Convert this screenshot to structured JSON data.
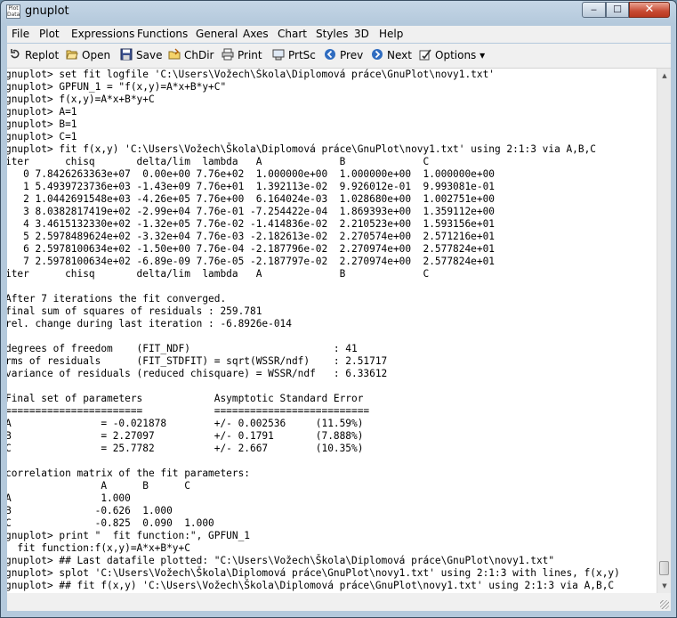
{
  "window": {
    "title": "gnuplot",
    "app_icon_text": "Plot Data"
  },
  "window_buttons": {
    "minimize": "‒",
    "maximize": "☐",
    "close": "✕"
  },
  "menu": [
    "File",
    "Plot",
    "Expressions",
    "Functions",
    "General",
    "Axes",
    "Chart",
    "Styles",
    "3D",
    "Help"
  ],
  "toolbar": [
    {
      "label": "Replot",
      "icon": "replot-icon"
    },
    {
      "label": "Open",
      "icon": "folder-open-icon"
    },
    {
      "label": "Save",
      "icon": "floppy-save-icon"
    },
    {
      "label": "ChDir",
      "icon": "change-dir-icon"
    },
    {
      "label": "Print",
      "icon": "printer-icon"
    },
    {
      "label": "PrtSc",
      "icon": "print-screen-icon"
    },
    {
      "label": "Prev",
      "icon": "prev-arrow-icon"
    },
    {
      "label": "Next",
      "icon": "next-arrow-icon"
    },
    {
      "label": "Options ▾",
      "icon": "options-icon"
    }
  ],
  "console_lines": [
    "gnuplot> set fit logfile 'C:\\Users\\Vožech\\Škola\\Diplomová práce\\GnuPlot\\novy1.txt'",
    "gnuplot> GPFUN_1 = \"f(x,y)=A*x+B*y+C\"",
    "gnuplot> f(x,y)=A*x+B*y+C",
    "gnuplot> A=1",
    "gnuplot> B=1",
    "gnuplot> C=1",
    "gnuplot> fit f(x,y) 'C:\\Users\\Vožech\\Škola\\Diplomová práce\\GnuPlot\\novy1.txt' using 2:1:3 via A,B,C",
    "iter      chisq       delta/lim  lambda   A             B             C",
    "   0 7.8426263363e+07  0.00e+00 7.76e+02  1.000000e+00  1.000000e+00  1.000000e+00",
    "   1 5.4939723736e+03 -1.43e+09 7.76e+01  1.392113e-02  9.926012e-01  9.993081e-01",
    "   2 1.0442691548e+03 -4.26e+05 7.76e+00  6.164024e-03  1.028680e+00  1.002751e+00",
    "   3 8.0382817419e+02 -2.99e+04 7.76e-01 -7.254422e-04  1.869393e+00  1.359112e+00",
    "   4 3.4615132330e+02 -1.32e+05 7.76e-02 -1.414836e-02  2.210523e+00  1.593156e+01",
    "   5 2.5978489624e+02 -3.32e+04 7.76e-03 -2.182613e-02  2.270574e+00  2.571216e+01",
    "   6 2.5978100634e+02 -1.50e+00 7.76e-04 -2.187796e-02  2.270974e+00  2.577824e+01",
    "   7 2.5978100634e+02 -6.89e-09 7.76e-05 -2.187797e-02  2.270974e+00  2.577824e+01",
    "iter      chisq       delta/lim  lambda   A             B             C",
    "",
    "After 7 iterations the fit converged.",
    "final sum of squares of residuals : 259.781",
    "rel. change during last iteration : -6.8926e-014",
    "",
    "degrees of freedom    (FIT_NDF)                        : 41",
    "rms of residuals      (FIT_STDFIT) = sqrt(WSSR/ndf)    : 2.51717",
    "variance of residuals (reduced chisquare) = WSSR/ndf   : 6.33612",
    "",
    "Final set of parameters            Asymptotic Standard Error",
    "=======================            ==========================",
    "A               = -0.021878        +/- 0.002536     (11.59%)",
    "B               = 2.27097          +/- 0.1791       (7.888%)",
    "C               = 25.7782          +/- 2.667        (10.35%)",
    "",
    "correlation matrix of the fit parameters:",
    "                A      B      C",
    "A               1.000",
    "B              -0.626  1.000",
    "C              -0.825  0.090  1.000",
    "gnuplot> print \"  fit function:\", GPFUN_1",
    "  fit function:f(x,y)=A*x+B*y+C",
    "gnuplot> ## Last datafile plotted: \"C:\\Users\\Vožech\\Škola\\Diplomová práce\\GnuPlot\\novy1.txt\"",
    "gnuplot> splot 'C:\\Users\\Vožech\\Škola\\Diplomová práce\\GnuPlot\\novy1.txt' using 2:1:3 with lines, f(x,y)",
    "gnuplot> ## fit f(x,y) 'C:\\Users\\Vožech\\Škola\\Diplomová práce\\GnuPlot\\novy1.txt' using 2:1:3 via A,B,C"
  ],
  "colors": {
    "console_bg": "#ffffff",
    "console_text": "#000000",
    "toolbar_bg": "#f0f0f0",
    "close_button": "#c74a33"
  }
}
